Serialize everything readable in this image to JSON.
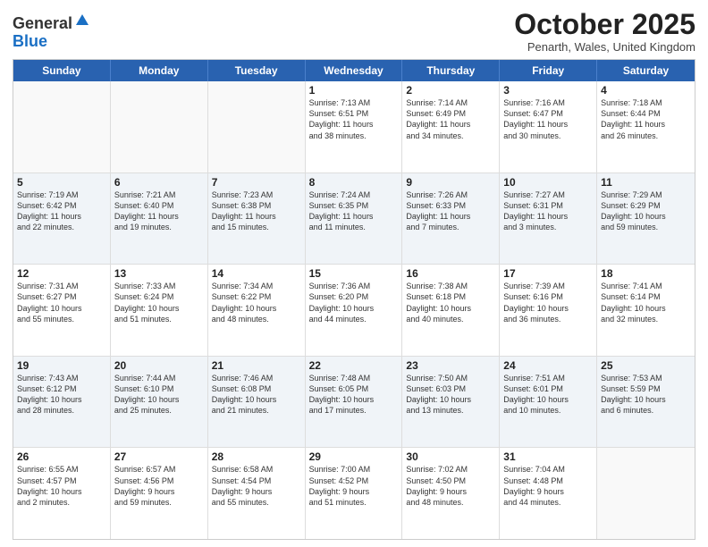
{
  "header": {
    "logo_general": "General",
    "logo_blue": "Blue",
    "month_title": "October 2025",
    "location": "Penarth, Wales, United Kingdom"
  },
  "days_of_week": [
    "Sunday",
    "Monday",
    "Tuesday",
    "Wednesday",
    "Thursday",
    "Friday",
    "Saturday"
  ],
  "weeks": [
    [
      {
        "day": "",
        "text": ""
      },
      {
        "day": "",
        "text": ""
      },
      {
        "day": "",
        "text": ""
      },
      {
        "day": "1",
        "text": "Sunrise: 7:13 AM\nSunset: 6:51 PM\nDaylight: 11 hours\nand 38 minutes."
      },
      {
        "day": "2",
        "text": "Sunrise: 7:14 AM\nSunset: 6:49 PM\nDaylight: 11 hours\nand 34 minutes."
      },
      {
        "day": "3",
        "text": "Sunrise: 7:16 AM\nSunset: 6:47 PM\nDaylight: 11 hours\nand 30 minutes."
      },
      {
        "day": "4",
        "text": "Sunrise: 7:18 AM\nSunset: 6:44 PM\nDaylight: 11 hours\nand 26 minutes."
      }
    ],
    [
      {
        "day": "5",
        "text": "Sunrise: 7:19 AM\nSunset: 6:42 PM\nDaylight: 11 hours\nand 22 minutes."
      },
      {
        "day": "6",
        "text": "Sunrise: 7:21 AM\nSunset: 6:40 PM\nDaylight: 11 hours\nand 19 minutes."
      },
      {
        "day": "7",
        "text": "Sunrise: 7:23 AM\nSunset: 6:38 PM\nDaylight: 11 hours\nand 15 minutes."
      },
      {
        "day": "8",
        "text": "Sunrise: 7:24 AM\nSunset: 6:35 PM\nDaylight: 11 hours\nand 11 minutes."
      },
      {
        "day": "9",
        "text": "Sunrise: 7:26 AM\nSunset: 6:33 PM\nDaylight: 11 hours\nand 7 minutes."
      },
      {
        "day": "10",
        "text": "Sunrise: 7:27 AM\nSunset: 6:31 PM\nDaylight: 11 hours\nand 3 minutes."
      },
      {
        "day": "11",
        "text": "Sunrise: 7:29 AM\nSunset: 6:29 PM\nDaylight: 10 hours\nand 59 minutes."
      }
    ],
    [
      {
        "day": "12",
        "text": "Sunrise: 7:31 AM\nSunset: 6:27 PM\nDaylight: 10 hours\nand 55 minutes."
      },
      {
        "day": "13",
        "text": "Sunrise: 7:33 AM\nSunset: 6:24 PM\nDaylight: 10 hours\nand 51 minutes."
      },
      {
        "day": "14",
        "text": "Sunrise: 7:34 AM\nSunset: 6:22 PM\nDaylight: 10 hours\nand 48 minutes."
      },
      {
        "day": "15",
        "text": "Sunrise: 7:36 AM\nSunset: 6:20 PM\nDaylight: 10 hours\nand 44 minutes."
      },
      {
        "day": "16",
        "text": "Sunrise: 7:38 AM\nSunset: 6:18 PM\nDaylight: 10 hours\nand 40 minutes."
      },
      {
        "day": "17",
        "text": "Sunrise: 7:39 AM\nSunset: 6:16 PM\nDaylight: 10 hours\nand 36 minutes."
      },
      {
        "day": "18",
        "text": "Sunrise: 7:41 AM\nSunset: 6:14 PM\nDaylight: 10 hours\nand 32 minutes."
      }
    ],
    [
      {
        "day": "19",
        "text": "Sunrise: 7:43 AM\nSunset: 6:12 PM\nDaylight: 10 hours\nand 28 minutes."
      },
      {
        "day": "20",
        "text": "Sunrise: 7:44 AM\nSunset: 6:10 PM\nDaylight: 10 hours\nand 25 minutes."
      },
      {
        "day": "21",
        "text": "Sunrise: 7:46 AM\nSunset: 6:08 PM\nDaylight: 10 hours\nand 21 minutes."
      },
      {
        "day": "22",
        "text": "Sunrise: 7:48 AM\nSunset: 6:05 PM\nDaylight: 10 hours\nand 17 minutes."
      },
      {
        "day": "23",
        "text": "Sunrise: 7:50 AM\nSunset: 6:03 PM\nDaylight: 10 hours\nand 13 minutes."
      },
      {
        "day": "24",
        "text": "Sunrise: 7:51 AM\nSunset: 6:01 PM\nDaylight: 10 hours\nand 10 minutes."
      },
      {
        "day": "25",
        "text": "Sunrise: 7:53 AM\nSunset: 5:59 PM\nDaylight: 10 hours\nand 6 minutes."
      }
    ],
    [
      {
        "day": "26",
        "text": "Sunrise: 6:55 AM\nSunset: 4:57 PM\nDaylight: 10 hours\nand 2 minutes."
      },
      {
        "day": "27",
        "text": "Sunrise: 6:57 AM\nSunset: 4:56 PM\nDaylight: 9 hours\nand 59 minutes."
      },
      {
        "day": "28",
        "text": "Sunrise: 6:58 AM\nSunset: 4:54 PM\nDaylight: 9 hours\nand 55 minutes."
      },
      {
        "day": "29",
        "text": "Sunrise: 7:00 AM\nSunset: 4:52 PM\nDaylight: 9 hours\nand 51 minutes."
      },
      {
        "day": "30",
        "text": "Sunrise: 7:02 AM\nSunset: 4:50 PM\nDaylight: 9 hours\nand 48 minutes."
      },
      {
        "day": "31",
        "text": "Sunrise: 7:04 AM\nSunset: 4:48 PM\nDaylight: 9 hours\nand 44 minutes."
      },
      {
        "day": "",
        "text": ""
      }
    ]
  ]
}
